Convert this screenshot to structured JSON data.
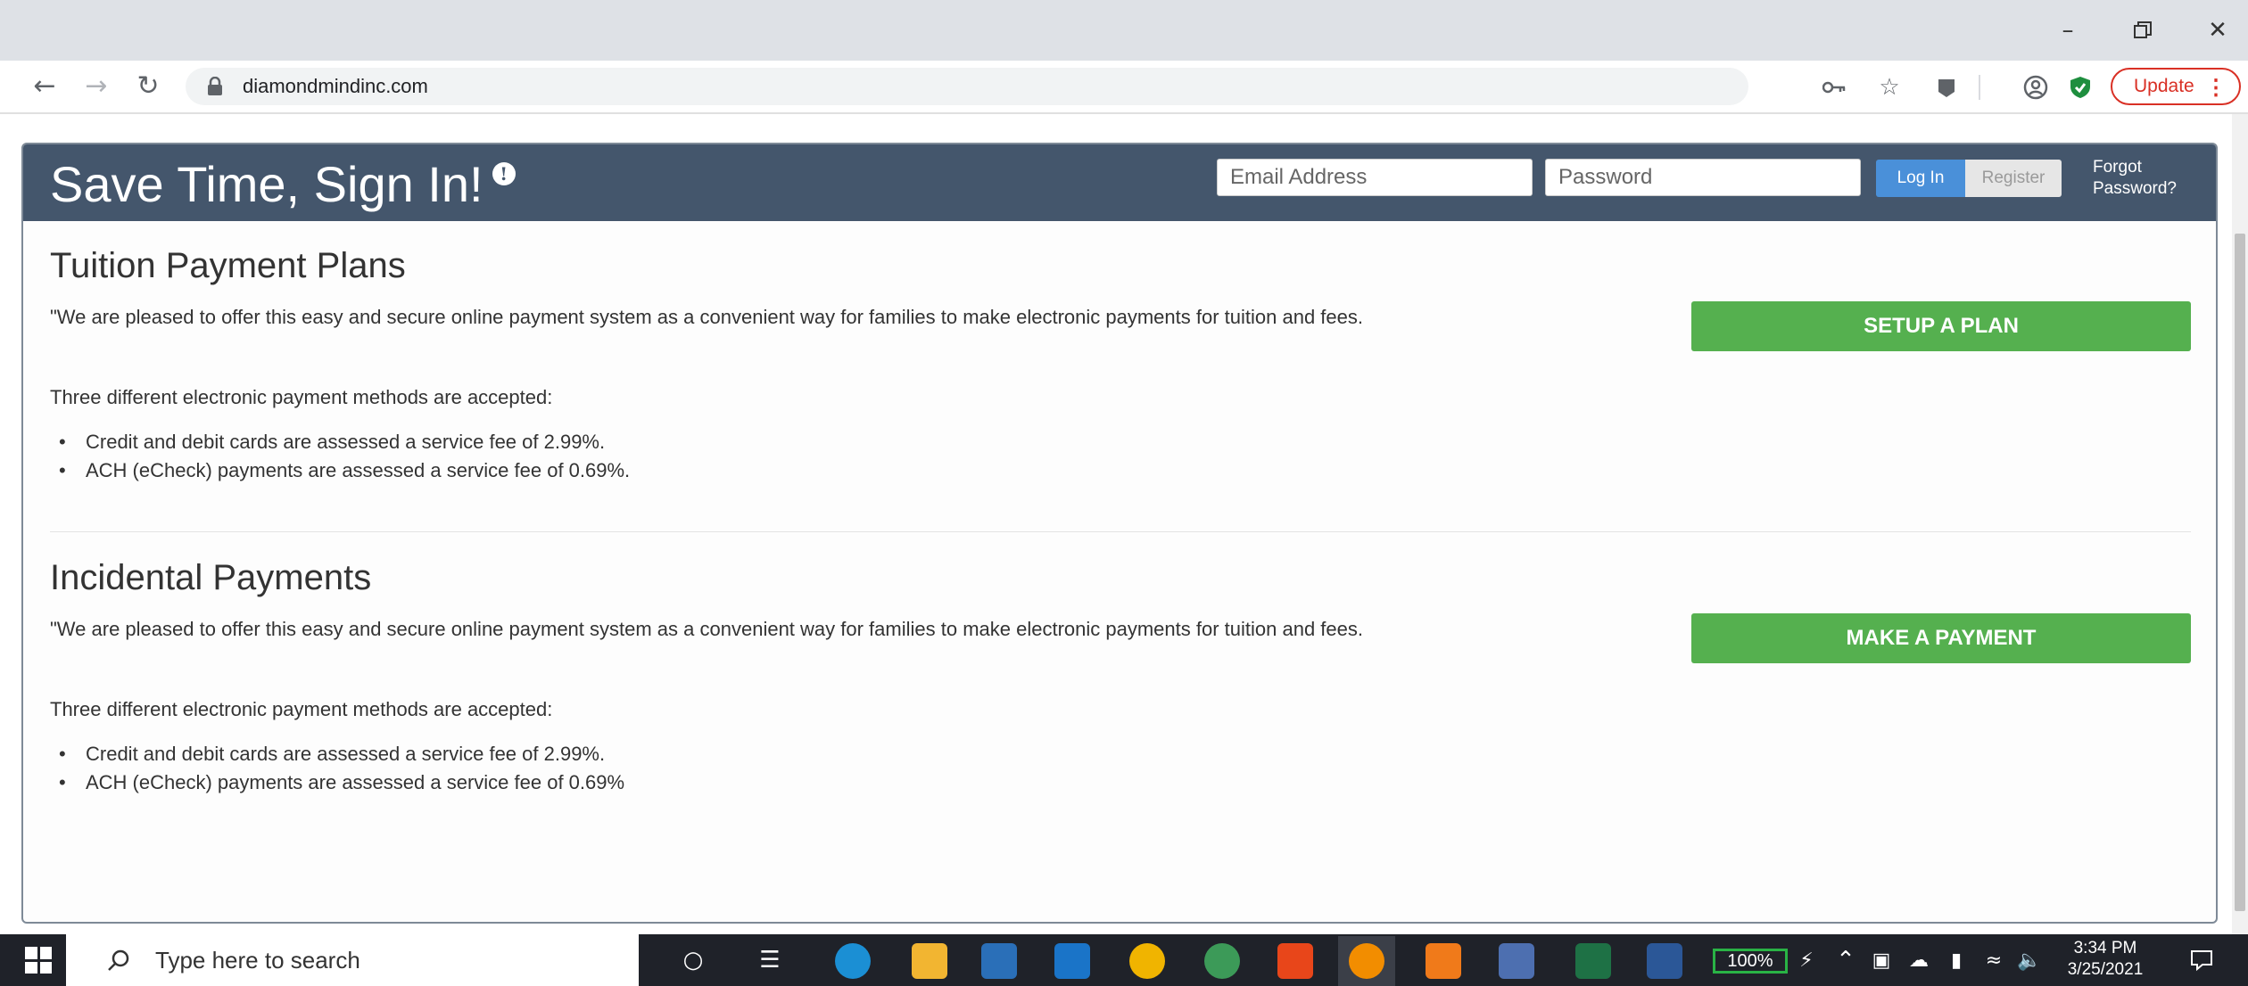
{
  "browser": {
    "url": "diamondmindinc.com",
    "update_label": "Update",
    "window_controls": [
      "minimize",
      "restore",
      "close"
    ]
  },
  "signin": {
    "title": "Save Time, Sign In!",
    "email_placeholder": "Email Address",
    "password_placeholder": "Password",
    "login_label": "Log In",
    "register_label": "Register",
    "forgot_label": "Forgot Password?"
  },
  "sections": [
    {
      "title": "Tuition Payment Plans",
      "intro": "\"We are pleased to offer this easy and secure online payment system as a convenient way for families to make electronic payments for tuition and fees.",
      "methods_heading": "Three different electronic payment methods are accepted:",
      "bullets": [
        "Credit and debit cards are assessed a service fee of 2.99%.",
        "ACH (eCheck) payments are assessed a service fee of 0.69%."
      ],
      "button_label": "SETUP A PLAN"
    },
    {
      "title": "Incidental Payments",
      "intro": "\"We are pleased to offer this easy and secure online payment system as a convenient way for families to make electronic payments for tuition and fees.",
      "methods_heading": "Three different electronic payment methods are accepted:",
      "bullets": [
        "Credit and debit cards are assessed a service fee of 2.99%.",
        "ACH (eCheck) payments are assessed a service fee of 0.69%"
      ],
      "button_label": "MAKE A PAYMENT"
    }
  ],
  "taskbar": {
    "search_placeholder": "Type here to search",
    "battery_label": "100%",
    "time": "3:34 PM",
    "date": "3/25/2021"
  },
  "colors": {
    "header_bg": "#44566c",
    "button_green": "#55b04f",
    "login_blue": "#4a90d9"
  }
}
